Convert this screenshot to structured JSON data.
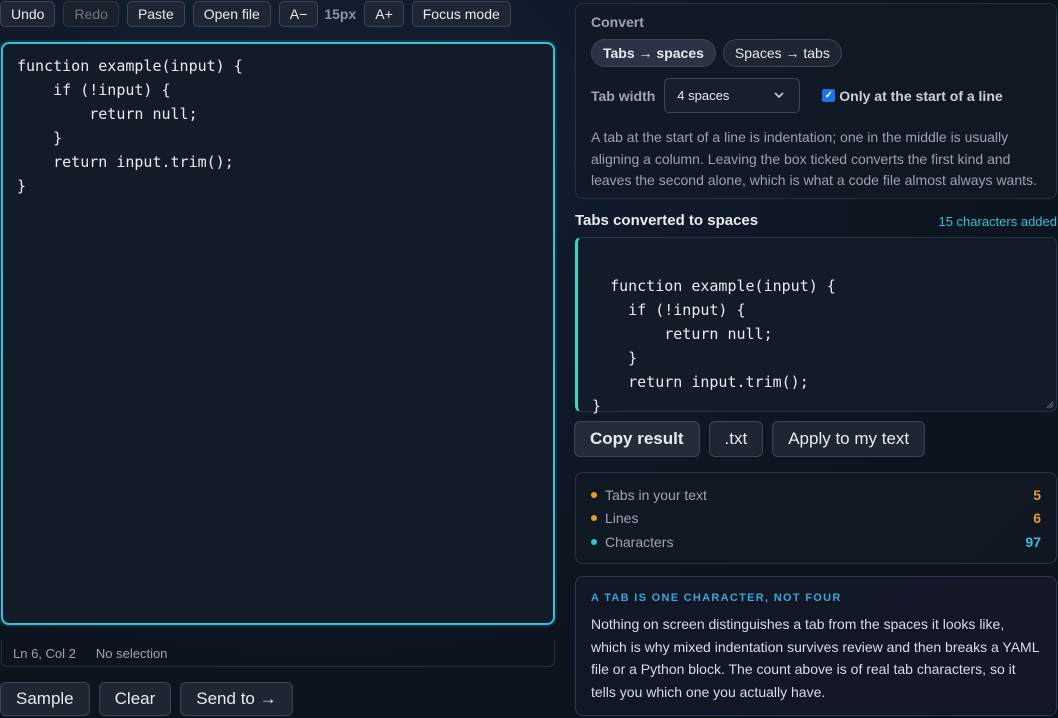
{
  "toolbar": {
    "undo": "Undo",
    "redo": "Redo",
    "paste": "Paste",
    "open_file": "Open file",
    "font_decrease": "A−",
    "font_size": "15px",
    "font_increase": "A+",
    "focus_mode": "Focus mode"
  },
  "editor": {
    "text": "function example(input) {\n\tif (!input) {\n\t\treturn null;\n\t}\n\treturn input.trim();\n}"
  },
  "status": {
    "position": "Ln 6, Col 2",
    "selection": "No selection"
  },
  "bottom": {
    "sample": "Sample",
    "clear": "Clear",
    "send_to": "Send to →"
  },
  "convert": {
    "title": "Convert",
    "mode_tabs_to_spaces": "Tabs → spaces",
    "mode_spaces_to_tabs": "Spaces → tabs",
    "active_mode": "Tabs → spaces",
    "tab_width_label": "Tab width",
    "tab_width_value": "4 spaces",
    "only_start_label": "Only at the start of a line",
    "only_start_checked": true,
    "description": "A tab at the start of a line is indentation; one in the middle is usually aligning a column. Leaving the box ticked converts the first kind and leaves the second alone, which is what a code file almost always wants."
  },
  "output": {
    "title": "Tabs converted to spaces",
    "count": "15 characters added",
    "text": "function example(input) {\n    if (!input) {\n        return null;\n    }\n    return input.trim();\n}"
  },
  "actions": {
    "copy": "Copy result",
    "txt": ".txt",
    "apply": "Apply to my text"
  },
  "stats": [
    {
      "label": "Tabs in your text",
      "value": "5",
      "color": "#e89a2c"
    },
    {
      "label": "Lines",
      "value": "6",
      "color": "#e89a2c"
    },
    {
      "label": "Characters",
      "value": "97",
      "color": "#39c0d8"
    }
  ],
  "note": {
    "heading": "A TAB IS ONE CHARACTER, NOT FOUR",
    "body": "Nothing on screen distinguishes a tab from the spaces it looks like, which is why mixed indentation survives review and then breaks a YAML file or a Python block. The count above is of real tab characters, so it tells you which one you actually have."
  },
  "colors": {
    "accent": "#39c0d8",
    "output_border": "#3dd6c4",
    "warning": "#e89a2c"
  }
}
